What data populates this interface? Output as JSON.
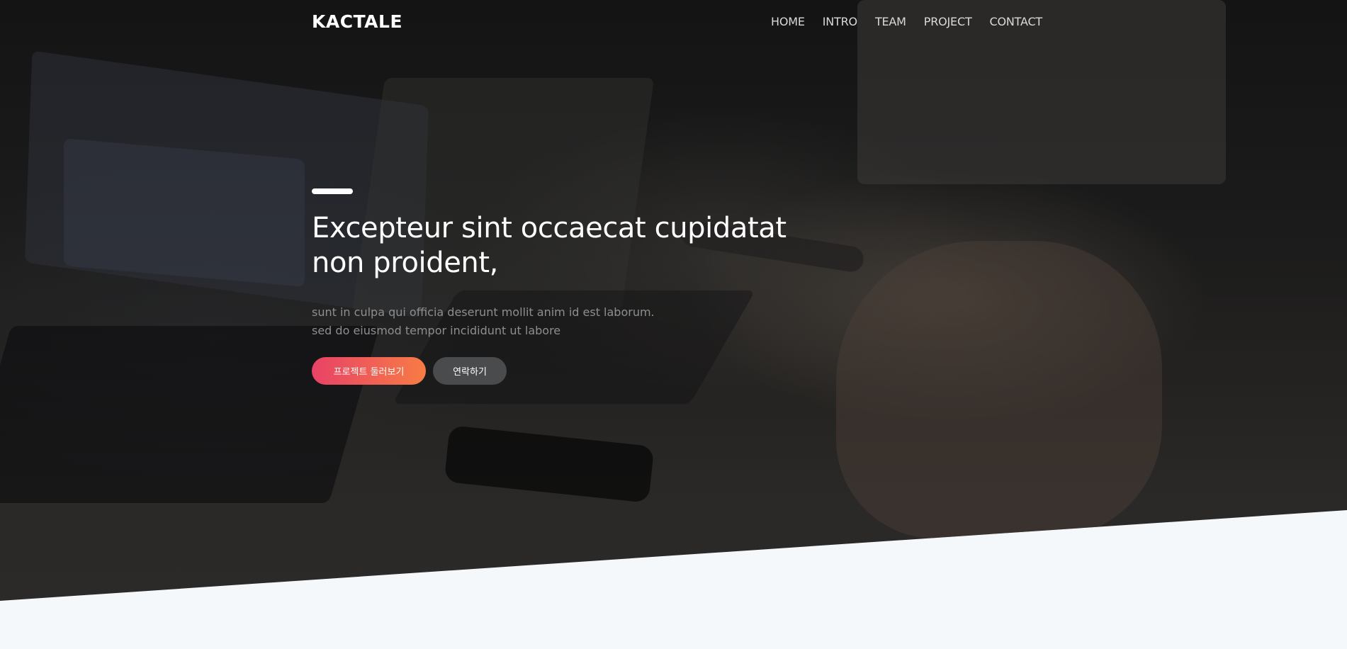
{
  "brand": {
    "logo_text": "KACTALE"
  },
  "nav": {
    "items": [
      {
        "label": "HOME"
      },
      {
        "label": "INTRO"
      },
      {
        "label": "TEAM"
      },
      {
        "label": "PROJECT"
      },
      {
        "label": "CONTACT"
      }
    ]
  },
  "hero": {
    "title_line1": "Excepteur sint occaecat cupidatat",
    "title_line2": "non proident,",
    "subtitle_line1": "sunt in culpa qui officia deserunt mollit anim id est laborum.",
    "subtitle_line2": "sed do eiusmod tempor incididunt ut labore",
    "primary_button_label": "프로젝트 둘러보기",
    "secondary_button_label": "연락하기"
  },
  "colors": {
    "primary_gradient_start": "#e84266",
    "primary_gradient_end": "#f77c45",
    "secondary_button": "#4a4b4d",
    "section_background": "#f4f8fb"
  }
}
